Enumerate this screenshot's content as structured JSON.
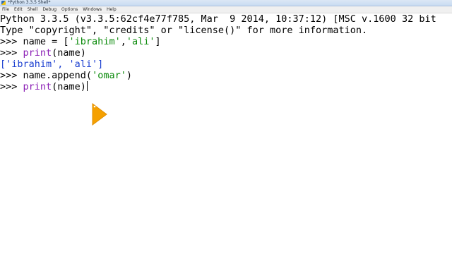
{
  "window": {
    "title": "*Python 3.3.5 Shell*"
  },
  "menu": {
    "items": [
      "File",
      "Edit",
      "Shell",
      "Debug",
      "Options",
      "Windows",
      "Help"
    ]
  },
  "shell": {
    "banner_line1": "Python 3.3.5 (v3.3.5:62cf4e77f785, Mar  9 2014, 10:37:12) [MSC v.1600 32 bit",
    "banner_line2": "Type \"copyright\", \"credits\" or \"license()\" for more information.",
    "prompt": ">>> ",
    "cmd1": {
      "pre": "name = [",
      "s1": "'ibrahim'",
      "comma": ",",
      "s2": "'ali'",
      "post": "]"
    },
    "cmd2": {
      "kw": "print",
      "rest": "(name)"
    },
    "output1": "['ibrahim', 'ali']",
    "cmd3": {
      "pre": "name.append(",
      "s1": "'omar'",
      "post": ")"
    },
    "cmd4": {
      "kw": "print",
      "rest": "(name)"
    }
  },
  "colors": {
    "output": "#1b3fd0",
    "keyword": "#8b1fb5",
    "string": "#0a8a0a",
    "pointer": "#f5a000"
  },
  "icons": {
    "app": "python-idle-icon",
    "pointer": "mouse-pointer-icon"
  }
}
